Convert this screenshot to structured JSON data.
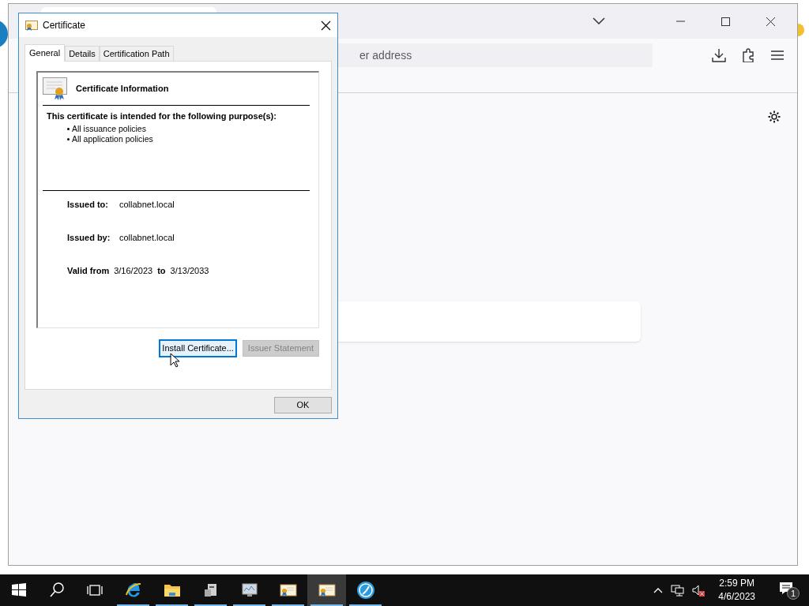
{
  "browser": {
    "address_field": {
      "placeholder": "er address"
    }
  },
  "dialog": {
    "title": "Certificate",
    "tabs": [
      {
        "label": "General",
        "selected": true
      },
      {
        "label": "Details",
        "selected": false
      },
      {
        "label": "Certification Path",
        "selected": false
      }
    ],
    "heading": "Certificate Information",
    "purpose_title": "This certificate is intended for the following purpose(s):",
    "purposes": [
      "All issuance policies",
      "All application policies"
    ],
    "fields": [
      {
        "label": "Issued to:",
        "value": "collabnet.local"
      },
      {
        "label": "Issued by:",
        "value": "collabnet.local"
      }
    ],
    "validity": {
      "label": "Valid from",
      "from": "3/16/2023",
      "to_label": "to",
      "to": "3/13/2033"
    },
    "buttons": [
      {
        "label": "Install Certificate...",
        "disabled": false,
        "focused": true
      },
      {
        "label": "Issuer Statement",
        "disabled": true,
        "focused": false
      }
    ],
    "ok": "OK"
  },
  "taskbar": {
    "apps": [
      {
        "kind": "ie",
        "running": true,
        "active": false
      },
      {
        "kind": "folder",
        "running": true,
        "active": false
      },
      {
        "kind": "server",
        "running": true,
        "active": false
      },
      {
        "kind": "monitor",
        "running": true,
        "active": false
      },
      {
        "kind": "cert",
        "running": true,
        "active": false
      },
      {
        "kind": "cert",
        "running": true,
        "active": true
      },
      {
        "kind": "circle",
        "running": true,
        "active": false
      }
    ],
    "time": "2:59 PM",
    "date": "4/6/2023",
    "notifications": "1"
  }
}
